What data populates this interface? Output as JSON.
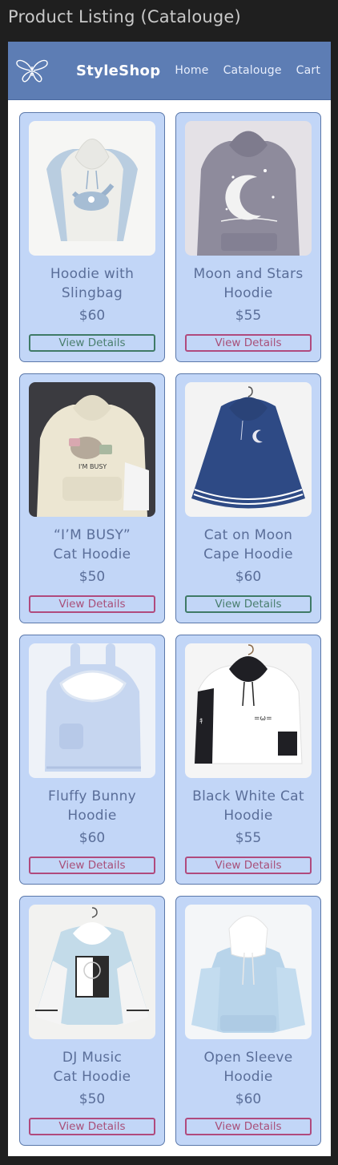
{
  "frame_title": "Product Listing (Catalouge)",
  "navbar": {
    "brand": "StyleShop",
    "links": [
      "Home",
      "Catalouge",
      "Cart"
    ]
  },
  "products": [
    {
      "name_line1": "Hoodie with",
      "name_line2": "Slingbag",
      "price": "$60",
      "button": "View Details",
      "button_style": "green",
      "image": "white-blue-hoodie-slingbag"
    },
    {
      "name_line1": "Moon and Stars",
      "name_line2": "Hoodie",
      "price": "$55",
      "button": "View Details",
      "button_style": "pink",
      "image": "grey-moon-stars-hoodie"
    },
    {
      "name_line1": "“I’M BUSY”",
      "name_line2": "Cat Hoodie",
      "price": "$50",
      "button": "View Details",
      "button_style": "pink",
      "image": "cream-busy-cat-hoodie"
    },
    {
      "name_line1": "Cat on Moon",
      "name_line2": "Cape Hoodie",
      "price": "$60",
      "button": "View Details",
      "button_style": "green",
      "image": "navy-cape-hoodie"
    },
    {
      "name_line1": "Fluffy Bunny",
      "name_line2": "Hoodie",
      "price": "$60",
      "button": "View Details",
      "button_style": "pink",
      "image": "blue-bunny-hoodie"
    },
    {
      "name_line1": "Black White Cat",
      "name_line2": "Hoodie",
      "price": "$55",
      "button": "View Details",
      "button_style": "pink",
      "image": "white-black-cat-hoodie"
    },
    {
      "name_line1": "DJ Music",
      "name_line2": "Cat Hoodie",
      "price": "$50",
      "button": "View Details",
      "button_style": "pink",
      "image": "blue-dj-cat-hoodie"
    },
    {
      "name_line1": "Open Sleeve",
      "name_line2": "Hoodie",
      "price": "$60",
      "button": "View Details",
      "button_style": "pink",
      "image": "blue-open-sleeve-hoodie"
    }
  ],
  "colors": {
    "navbar": "#5d7db4",
    "card_bg": "#c2d6f7",
    "card_border": "#5b78aa",
    "text": "#5a6e99",
    "button_green": "#3f7a66",
    "button_pink": "#b04a7d"
  }
}
